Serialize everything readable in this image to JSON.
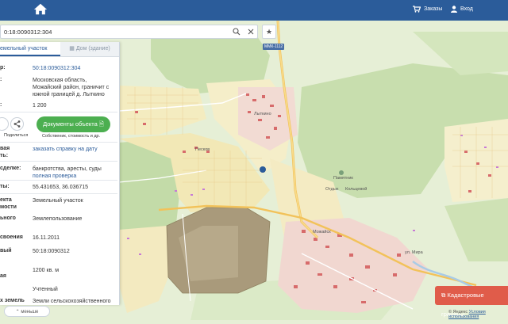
{
  "header": {
    "orders_label": "Заказы",
    "login_label": "Вход"
  },
  "search": {
    "value": "0:18:0090312:304"
  },
  "map": {
    "road_badge": "ММК-1112",
    "places": [
      "Лыткино",
      "Песков",
      "Можайск",
      "Памятник",
      "Отдых",
      "Кольцевой",
      "ул. Мира"
    ],
    "cadastral_button": "Кадастровые границы",
    "attribution_text": "© Яндекс",
    "attribution_link": "Условия использования"
  },
  "panel": {
    "tabs": {
      "land": "емельный участок",
      "house": "Дом (здание)"
    },
    "rows": [
      {
        "label": "р:",
        "value": "50:18:0090312:304"
      },
      {
        "label": ":",
        "value": "Московская область, Можайский район, граничит с южной границей д. Лыткино"
      },
      {
        "label": ":",
        "value": "1 200"
      }
    ],
    "share_label": "Поделиться",
    "documents_button": "Документы объекта",
    "documents_caption": "Собственик, стоимость и др.",
    "rows2": [
      {
        "label": "вая",
        "label2": "ть:",
        "value": "заказать справку на дату"
      },
      {
        "label": "сделке:",
        "value": "банкротства, аресты, суды",
        "value2": "полная проверка"
      },
      {
        "label": "ты:",
        "value": "55.431653, 36.036715"
      },
      {
        "label": "екта",
        "label2": "мости",
        "value": "Земельный участок"
      },
      {
        "label": "ьного",
        "value": "Землепользование"
      },
      {
        "label": "своения",
        "value": "16.11.2011"
      },
      {
        "label": "вый",
        "value": "50:18:0090312"
      },
      {
        "label": "ая",
        "value": "1200 кв. м"
      },
      {
        "label": "",
        "value": "Учтенный"
      },
      {
        "label": "х земель",
        "value": "Земли сельскохозяйственного"
      }
    ],
    "less_label": "меньше"
  }
}
